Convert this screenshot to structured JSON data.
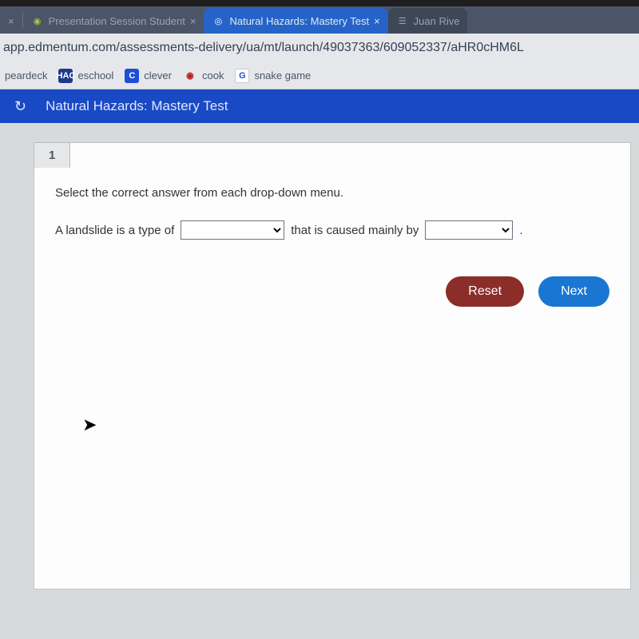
{
  "tabs": {
    "tab0_close": "×",
    "tab1_label": "Presentation Session Student",
    "tab1_close": "×",
    "tab_active_label": "Natural Hazards: Mastery Test",
    "tab_active_close": "×",
    "tab_right_label": "Juan Rive"
  },
  "url": "app.edmentum.com/assessments-delivery/ua/mt/launch/49037363/609052337/aHR0cHM6L",
  "bookmarks": {
    "b1": "peardeck",
    "b2": "eschool",
    "b2_icon": "HAC",
    "b3": "clever",
    "b3_icon": "C",
    "b4": "cook",
    "b5": "snake game",
    "b5_icon": "G"
  },
  "app": {
    "nav_icon": "↻",
    "title": "Natural Hazards: Mastery Test"
  },
  "question": {
    "number": "1",
    "instruction": "Select the correct answer from each drop-down menu.",
    "part1": "A landslide is a type of",
    "part2": "that is caused mainly by",
    "period": "."
  },
  "buttons": {
    "reset": "Reset",
    "next": "Next"
  }
}
